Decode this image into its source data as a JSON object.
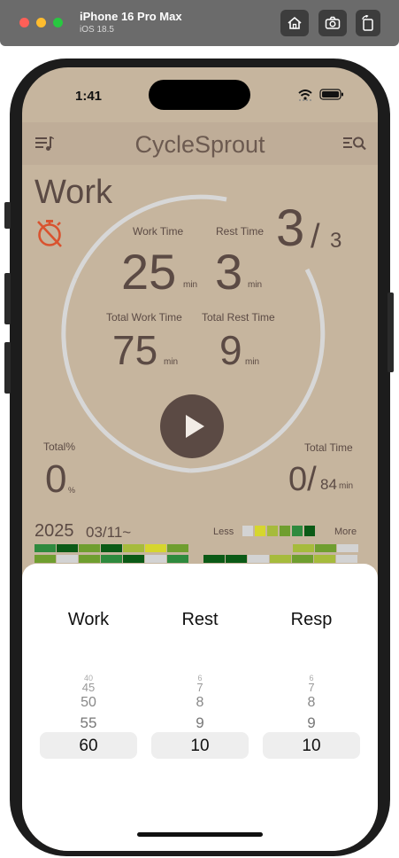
{
  "simulator": {
    "device": "iPhone 16 Pro Max",
    "os": "iOS 18.5"
  },
  "status": {
    "time": "1:41"
  },
  "app": {
    "title": "CycleSprout"
  },
  "timer": {
    "mode": "Work",
    "work_time_label": "Work Time",
    "work_time_value": "25",
    "work_time_unit": "min",
    "rest_time_label": "Rest Time",
    "rest_time_value": "3",
    "rest_time_unit": "min",
    "total_work_label": "Total Work Time",
    "total_work_value": "75",
    "total_work_unit": "min",
    "total_rest_label": "Total Rest Time",
    "total_rest_value": "9",
    "total_rest_unit": "min",
    "cycle_current": "3",
    "cycle_separator": "/",
    "cycle_total": "3",
    "total_pct_label": "Total%",
    "total_pct_value": "0",
    "total_pct_unit": "%",
    "total_time_label": "Total Time",
    "total_time_value": "0/",
    "total_time_max": "84",
    "total_time_unit": "min"
  },
  "history": {
    "year": "2025",
    "start_date": "03/11~",
    "legend_less": "Less",
    "legend_more": "More",
    "legend_colors": [
      "#d3d3d3",
      "#d6d62e",
      "#a6bb3c",
      "#6f9e2f",
      "#2e8a3e",
      "#0b5a16"
    ]
  },
  "picker": {
    "work": {
      "header": "Work",
      "options": [
        "40",
        "45",
        "50",
        "55"
      ],
      "selected": "60"
    },
    "rest": {
      "header": "Rest",
      "options": [
        "6",
        "7",
        "8",
        "9"
      ],
      "selected": "10"
    },
    "resp": {
      "header": "Resp",
      "options": [
        "6",
        "7",
        "8",
        "9"
      ],
      "selected": "10"
    }
  },
  "colors": {
    "accent": "#5b4a44",
    "background": "#c6b59e",
    "navbar": "#bfad98",
    "timer_icon": "#d9532f"
  }
}
